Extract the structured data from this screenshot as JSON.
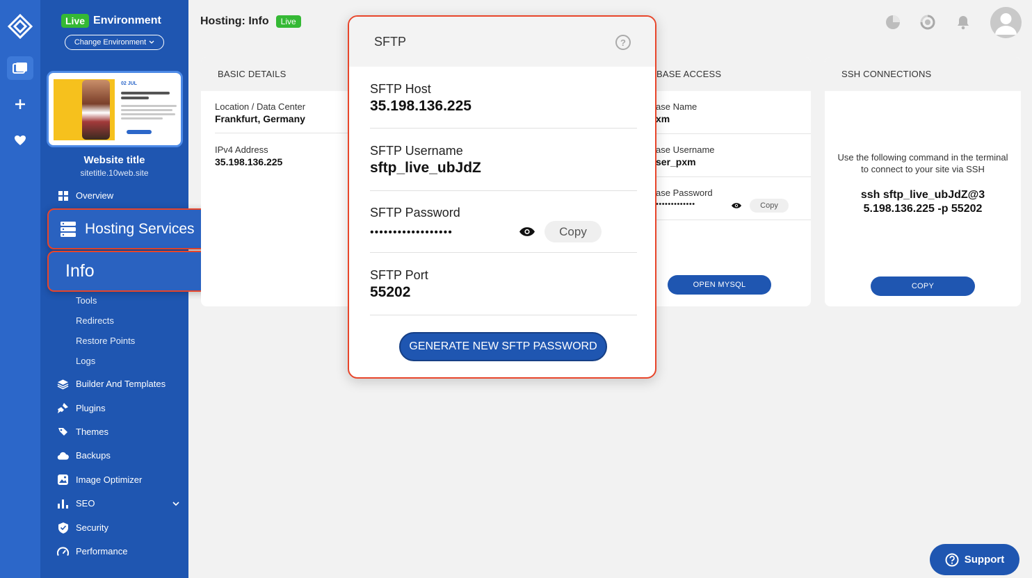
{
  "environment": {
    "badge": "Live",
    "label": "Environment",
    "change_label": "Change Environment"
  },
  "site": {
    "title": "Website title",
    "url": "sitetitle.10web.site",
    "thumb_date": "02 JUL"
  },
  "nav": {
    "overview": "Overview",
    "hosting_services": "Hosting Services",
    "info": "Info",
    "sub_items": [
      "Tools",
      "Redirects",
      "Restore Points",
      "Logs"
    ],
    "builder": "Builder And Templates",
    "plugins": "Plugins",
    "themes": "Themes",
    "backups": "Backups",
    "image_optimizer": "Image Optimizer",
    "seo": "SEO",
    "security": "Security",
    "performance": "Performance"
  },
  "header": {
    "title": "Hosting: Info",
    "badge": "Live"
  },
  "basic_details": {
    "heading": "BASIC DETAILS",
    "location_label": "Location / Data Center",
    "location_value": "Frankfurt, Germany",
    "ip_label": "IPv4 Address",
    "ip_value": "35.198.136.225"
  },
  "database": {
    "heading": "BASE ACCESS",
    "name_label": "ase Name",
    "name_value": "xm",
    "user_label": "ase Username",
    "user_value": "ser_pxm",
    "password_label": "ase Password",
    "password_dots": "•••••••••••••",
    "copy_label": "Copy",
    "open_button": "OPEN MYSQL"
  },
  "ssh": {
    "heading": "SSH CONNECTIONS",
    "desc_line1": "Use the following command in the terminal",
    "desc_line2": "to connect to your site via SSH",
    "cmd_line1": "ssh sftp_live_ubJdZ@3",
    "cmd_line2": "5.198.136.225 -p 55202",
    "copy_button": "COPY"
  },
  "modal": {
    "title": "SFTP",
    "help": "?",
    "host_label": "SFTP Host",
    "host_value": "35.198.136.225",
    "username_label": "SFTP Username",
    "username_value": "sftp_live_ubJdZ",
    "password_label": "SFTP Password",
    "password_dots": "••••••••••••••••••",
    "copy_label": "Copy",
    "port_label": "SFTP Port",
    "port_value": "55202",
    "generate_button": "GENERATE NEW SFTP PASSWORD"
  },
  "support": {
    "label": "Support"
  },
  "colors": {
    "rail": "#2c67c9",
    "sidebar": "#1f56b1",
    "live_green": "#35b935",
    "highlight_red": "#e8452a",
    "primary_button": "#1f56b1"
  }
}
